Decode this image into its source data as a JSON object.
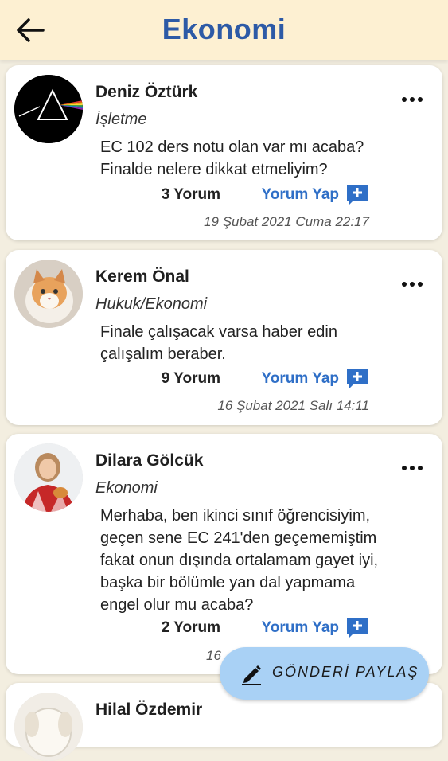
{
  "header": {
    "title": "Ekonomi",
    "back_icon": "arrow-left-icon"
  },
  "posts": [
    {
      "author": "Deniz Öztürk",
      "department": "İşletme",
      "text": "EC 102 ders notu olan var mı acaba?\nFinalde nelere dikkat etmeliyim?",
      "comment_count": "3 Yorum",
      "comment_action": "Yorum Yap",
      "date": "19 Şubat 2021 Cuma 22:17"
    },
    {
      "author": "Kerem Önal",
      "department": "Hukuk/Ekonomi",
      "text": "Finale çalışacak varsa haber edin\nçalışalım beraber.",
      "comment_count": "9 Yorum",
      "comment_action": "Yorum Yap",
      "date": "16 Şubat 2021 Salı 14:11"
    },
    {
      "author": "Dilara Gölcük",
      "department": "Ekonomi",
      "text": "Merhaba, ben ikinci sınıf öğrencisiyim,\ngeçen sene EC 241'den geçememiştim\nfakat onun dışında ortalamam gayet iyi,\nbaşka bir bölümle yan dal yapmama\nengel olur mu acaba?",
      "comment_count": "2 Yorum",
      "comment_action": "Yorum Yap",
      "date": "16"
    },
    {
      "author": "Hilal Özdemir"
    }
  ],
  "fab": {
    "label": "GÖNDERİ PAYLAŞ",
    "icon": "pencil-icon"
  },
  "colors": {
    "header_bg": "#fdf0d2",
    "title": "#2d5aa6",
    "link": "#2f6fc7",
    "fab_bg": "#a9d1f5",
    "page_bg": "#f3eee0"
  }
}
